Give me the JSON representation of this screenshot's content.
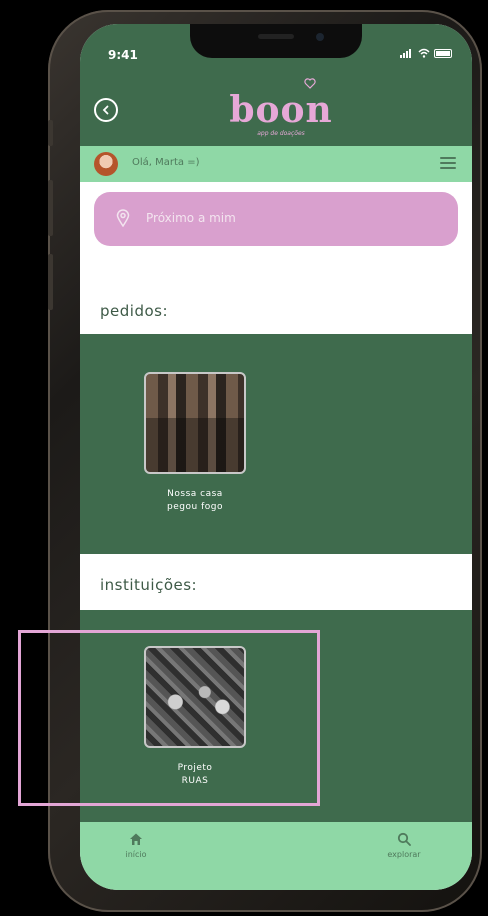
{
  "status_bar": {
    "time": "9:41"
  },
  "header": {
    "logo": "boon",
    "logo_subtitle": "app de doações"
  },
  "greeting": {
    "text": "Olá, Marta =)"
  },
  "search": {
    "label": "Próximo a mim"
  },
  "sections": [
    {
      "title": "pedidos:",
      "cards": [
        {
          "label_line1": "Nossa casa",
          "label_line2": "pegou fogo"
        }
      ]
    },
    {
      "title": "instituições:",
      "cards": [
        {
          "label_line1": "Projeto",
          "label_line2": "RUAS"
        }
      ]
    }
  ],
  "tab_bar": {
    "home_label": "início",
    "explore_label": "explorar"
  },
  "colors": {
    "primary_green": "#3f6b4d",
    "mint": "#8fd8a6",
    "pink": "#d9a0ce",
    "highlight": "#e3a6d6"
  },
  "icons": [
    "back-icon",
    "heart-icon",
    "menu-icon",
    "location-pin-icon",
    "home-icon",
    "search-icon"
  ]
}
